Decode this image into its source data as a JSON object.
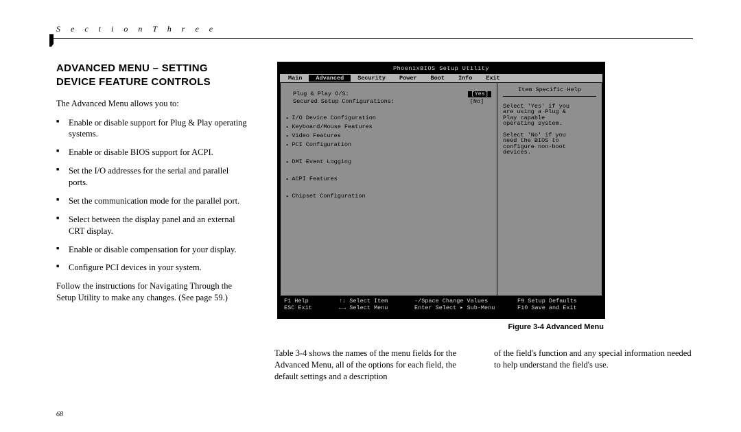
{
  "section_label": "S e c t i o n   T h r e e",
  "title_line1": "ADVANCED MENU – SETTING",
  "title_line2": "DEVICE FEATURE CONTROLS",
  "lead": "The Advanced Menu allows you to:",
  "bullets": [
    "Enable or disable support for Plug & Play operating systems.",
    "Enable or disable BIOS support for ACPI.",
    "Set the I/O addresses for the serial and parallel ports.",
    "Set the communication mode for the parallel port.",
    "Select between the display panel and an external CRT display.",
    "Enable or disable compensation for your display.",
    "Configure PCI devices in your system."
  ],
  "follow": "Follow the instructions for Navigating Through the Setup Utility to make any changes. (See page 59.)",
  "bios": {
    "title": "PhoenixBIOS Setup Utility",
    "tabs": [
      "Main",
      "Advanced",
      "Security",
      "Power",
      "Boot",
      "Info",
      "Exit"
    ],
    "active_tab": "Advanced",
    "options": [
      {
        "label": "Plug & Play O/S:",
        "value": "[Yes]",
        "highlight": true
      },
      {
        "label": "Secured Setup Configurations:",
        "value": "[No]",
        "highlight": false
      }
    ],
    "submenus_group1": [
      "I/O Device Configuration",
      "Keyboard/Mouse Features",
      "Video Features",
      "PCI Configuration"
    ],
    "submenus_group2": [
      "DMI Event Logging"
    ],
    "submenus_group3": [
      "ACPI Features"
    ],
    "submenus_group4": [
      "Chipset Configuration"
    ],
    "help_title": "Item Specific Help",
    "help_lines": [
      "Select 'Yes' if you",
      "are using a Plug &",
      "Play capable",
      "operating system.",
      "",
      "Select 'No' if you",
      "need the BIOS to",
      "configure non-boot",
      "devices."
    ],
    "footer": {
      "r1c1": "F1  Help",
      "r1c2": "↑↓ Select Item",
      "r1c3": "-/Space  Change Values",
      "r1c4": "F9   Setup Defaults",
      "r2c1": "ESC Exit",
      "r2c2": "←→ Select Menu",
      "r2c3": "Enter  Select ▸ Sub-Menu",
      "r2c4": "F10  Save and Exit"
    }
  },
  "figure_caption": "Figure 3-4 Advanced Menu",
  "body_col1": "Table 3-4 shows the names of the menu fields for the Advanced Menu, all of the options for each field, the default settings and a description",
  "body_col2": "of the field's function and any special information needed to help understand the field's use.",
  "page_number": "68"
}
